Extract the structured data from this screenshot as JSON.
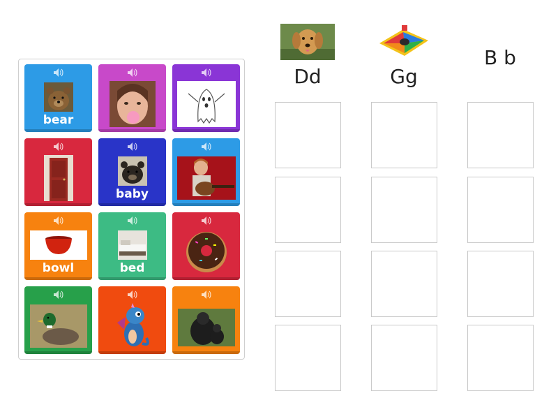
{
  "colors": {
    "blue": "#2d9be6",
    "magenta": "#c849c9",
    "purple": "#8a35d6",
    "red": "#d8283e",
    "navy": "#2934c8",
    "orange": "#f7820f",
    "green": "#3dbb84",
    "darkgreen": "#27a04a",
    "redorange": "#f04b0f"
  },
  "tiles": [
    {
      "label": "bear",
      "picture": "bear-photo"
    },
    {
      "label": "",
      "picture": "girl-bubblegum-photo"
    },
    {
      "label": "",
      "picture": "ghost-drawing"
    },
    {
      "label": "",
      "picture": "door-photo"
    },
    {
      "label": "baby",
      "picture": "bear-cub-photo"
    },
    {
      "label": "",
      "picture": "boy-guitar-photo"
    },
    {
      "label": "bowl",
      "picture": "bowl-photo"
    },
    {
      "label": "bed",
      "picture": "bed-photo"
    },
    {
      "label": "",
      "picture": "donut-photo"
    },
    {
      "label": "",
      "picture": "duck-photo"
    },
    {
      "label": "",
      "picture": "dragon-cartoon"
    },
    {
      "label": "",
      "picture": "gorilla-photo"
    }
  ],
  "columns": [
    {
      "header": "Dd",
      "picture": "dog-photo"
    },
    {
      "header": "Gg",
      "picture": "board-game-picture"
    },
    {
      "header": "B b",
      "picture": ""
    }
  ]
}
